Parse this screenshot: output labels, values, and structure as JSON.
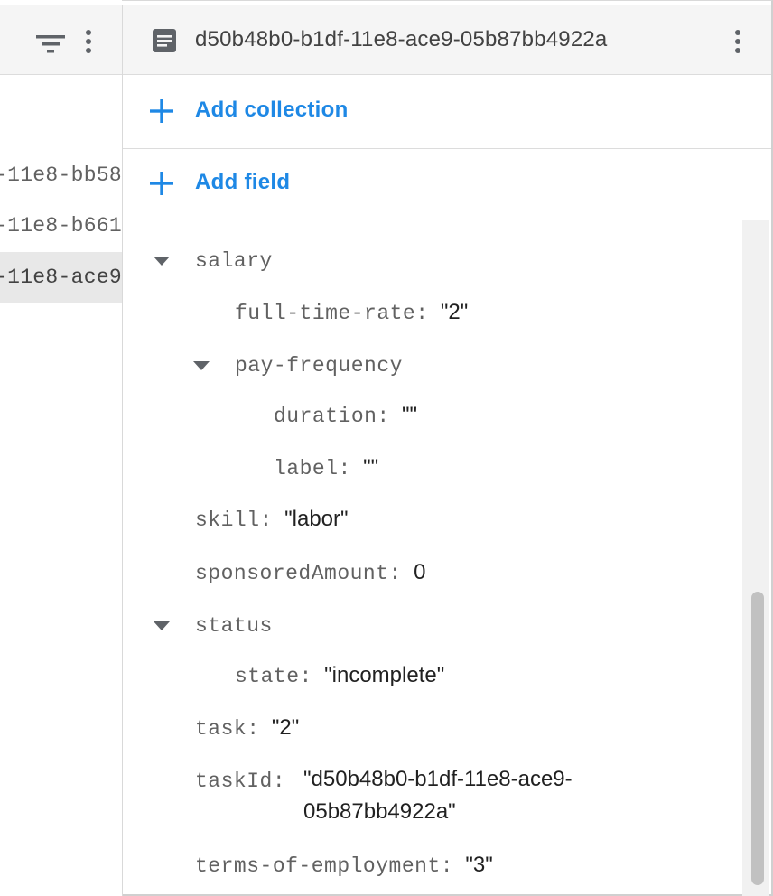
{
  "left_panel": {
    "documents": [
      {
        "label": "-11e8-bb58"
      },
      {
        "label": "-11e8-b661"
      },
      {
        "label": "-11e8-ace9"
      }
    ]
  },
  "document": {
    "title": "d50b48b0-b1df-11e8-ace9-05b87bb4922a",
    "add_collection_label": "Add collection",
    "add_field_label": "Add field"
  },
  "fields": {
    "salary": {
      "key": "salary"
    },
    "full_time_rate": {
      "key": "full-time-rate",
      "value": "\"2\""
    },
    "pay_frequency": {
      "key": "pay-frequency"
    },
    "duration": {
      "key": "duration",
      "value": "\"\""
    },
    "label": {
      "key": "label",
      "value": "\"\""
    },
    "skill": {
      "key": "skill",
      "value": "\"labor\""
    },
    "sponsoredAmount": {
      "key": "sponsoredAmount",
      "value": "0"
    },
    "status": {
      "key": "status"
    },
    "state": {
      "key": "state",
      "value": "\"incomplete\""
    },
    "task": {
      "key": "task",
      "value": "\"2\""
    },
    "taskId": {
      "key": "taskId",
      "value_line1": "\"d50b48b0-b1df-11e8-ace9-",
      "value_line2": "05b87bb4922a\""
    },
    "terms": {
      "key": "terms-of-employment",
      "value": "\"3\""
    }
  },
  "icons": {
    "filter": "filter-icon",
    "more": "more-vert-icon",
    "document": "document-icon",
    "add": "plus-icon",
    "expand": "triangle-down-icon"
  },
  "colors": {
    "accent": "#1e88e5",
    "key_text": "#616161",
    "value_text": "#212121",
    "header_bg": "#f5f5f5"
  }
}
